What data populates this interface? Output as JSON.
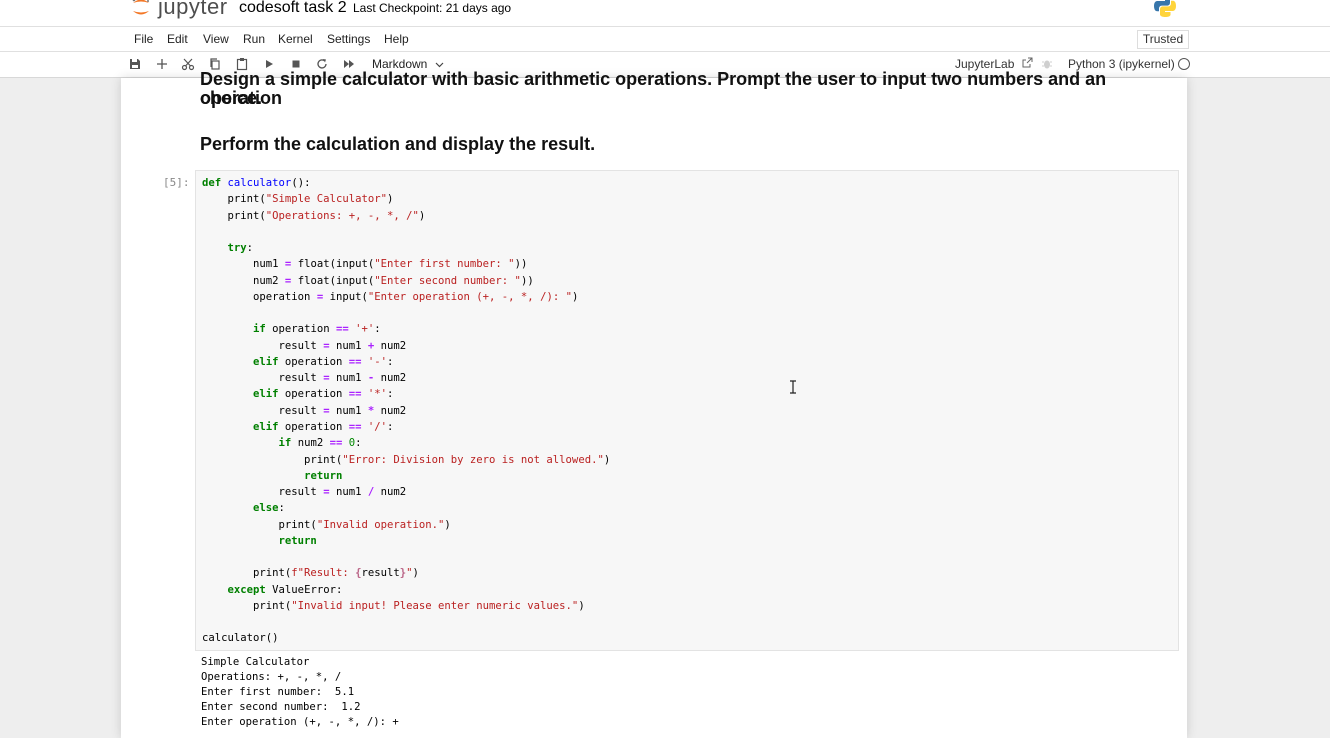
{
  "header": {
    "logo_text": "jupyter",
    "notebook_title": "codesoft task 2",
    "checkpoint": "Last Checkpoint: 21 days ago"
  },
  "menu": {
    "items": [
      "File",
      "Edit",
      "View",
      "Run",
      "Kernel",
      "Settings",
      "Help"
    ],
    "trusted": "Trusted"
  },
  "toolbar": {
    "cell_type": "Markdown",
    "jupyterlab": "JupyterLab",
    "kernel": "Python 3 (ipykernel)"
  },
  "markdown": {
    "line1": "Design a simple calculator with basic arithmetic operations. Prompt the user to input two numbers and an operation",
    "line2": "choice.",
    "line3": "Perform the calculation and display the result."
  },
  "cell": {
    "prompt": "[5]:",
    "output_lines": [
      "Simple Calculator",
      "Operations: +, -, *, /",
      "Enter first number:  5.1",
      "Enter second number:  1.2",
      "Enter operation (+, -, *, /): +"
    ]
  },
  "colors": {
    "keyword": "#008000",
    "string": "#ba2121",
    "operator": "#aa22ff",
    "function": "#0000ff"
  }
}
